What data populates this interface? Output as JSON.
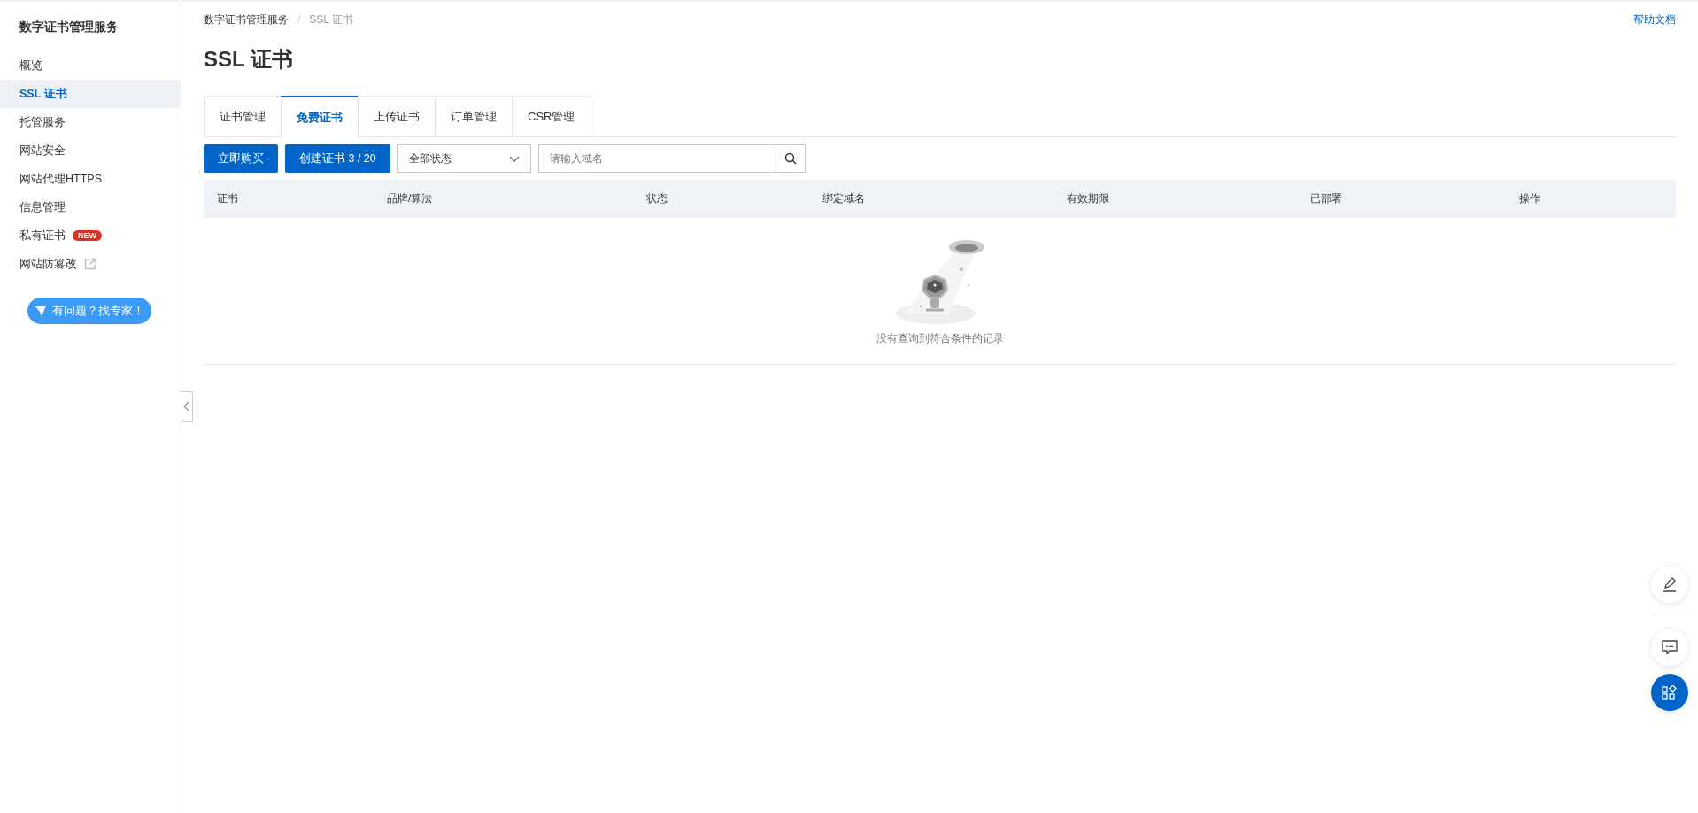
{
  "sidebar": {
    "title": "数字证书管理服务",
    "items": [
      {
        "label": "概览",
        "selected": false
      },
      {
        "label": "SSL 证书",
        "selected": true
      },
      {
        "label": "托管服务",
        "selected": false
      },
      {
        "label": "网站安全",
        "selected": false
      },
      {
        "label": "网站代理HTTPS",
        "selected": false
      },
      {
        "label": "信息管理",
        "selected": false
      },
      {
        "label": "私有证书",
        "selected": false,
        "badge": "NEW"
      },
      {
        "label": "网站防篡改",
        "selected": false,
        "external": true
      }
    ],
    "expert_button": "有问题？找专家！"
  },
  "breadcrumb": [
    "数字证书管理服务",
    "SSL 证书"
  ],
  "breadcrumb_separator": "/",
  "help_link": "帮助文档",
  "page_title": "SSL 证书",
  "tabs": [
    {
      "label": "证书管理",
      "selected": false
    },
    {
      "label": "免费证书",
      "selected": true
    },
    {
      "label": "上传证书",
      "selected": false
    },
    {
      "label": "订单管理",
      "selected": false
    },
    {
      "label": "CSR管理",
      "selected": false
    }
  ],
  "toolbar": {
    "buy_button": "立即购买",
    "create_button": "创建证书 3 / 20",
    "status_select": "全部状态",
    "search": {
      "placeholder": "请输入域名"
    }
  },
  "table": {
    "columns": [
      "证书",
      "品牌/算法",
      "状态",
      "绑定域名",
      "有效期限",
      "已部署",
      "操作"
    ],
    "empty_text": "没有查询到符合条件的记录"
  }
}
